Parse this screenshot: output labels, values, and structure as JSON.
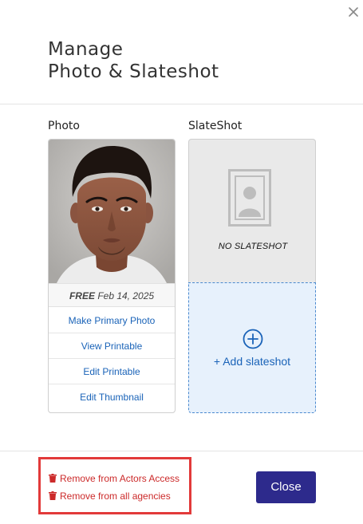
{
  "modal": {
    "title_line1": "Manage",
    "title_line2": "Photo & Slateshot",
    "close_icon": "close-icon"
  },
  "photo": {
    "label": "Photo",
    "meta_free": "FREE",
    "meta_date": "Feb 14, 2025",
    "actions": [
      {
        "label": "Make Primary Photo"
      },
      {
        "label": "View Printable"
      },
      {
        "label": "Edit Printable"
      },
      {
        "label": "Edit Thumbnail"
      }
    ]
  },
  "slateshot": {
    "label": "SlateShot",
    "empty_text": "NO SLATESHOT",
    "add_label": "+ Add slateshot"
  },
  "footer": {
    "remove_actors_access": "Remove from Actors Access",
    "remove_all_agencies": "Remove from all agencies",
    "close_label": "Close"
  },
  "colors": {
    "link": "#1a63b8",
    "danger": "#cc2a2a",
    "primary_button": "#2d2a8c",
    "highlight_border": "#e23a3a"
  }
}
